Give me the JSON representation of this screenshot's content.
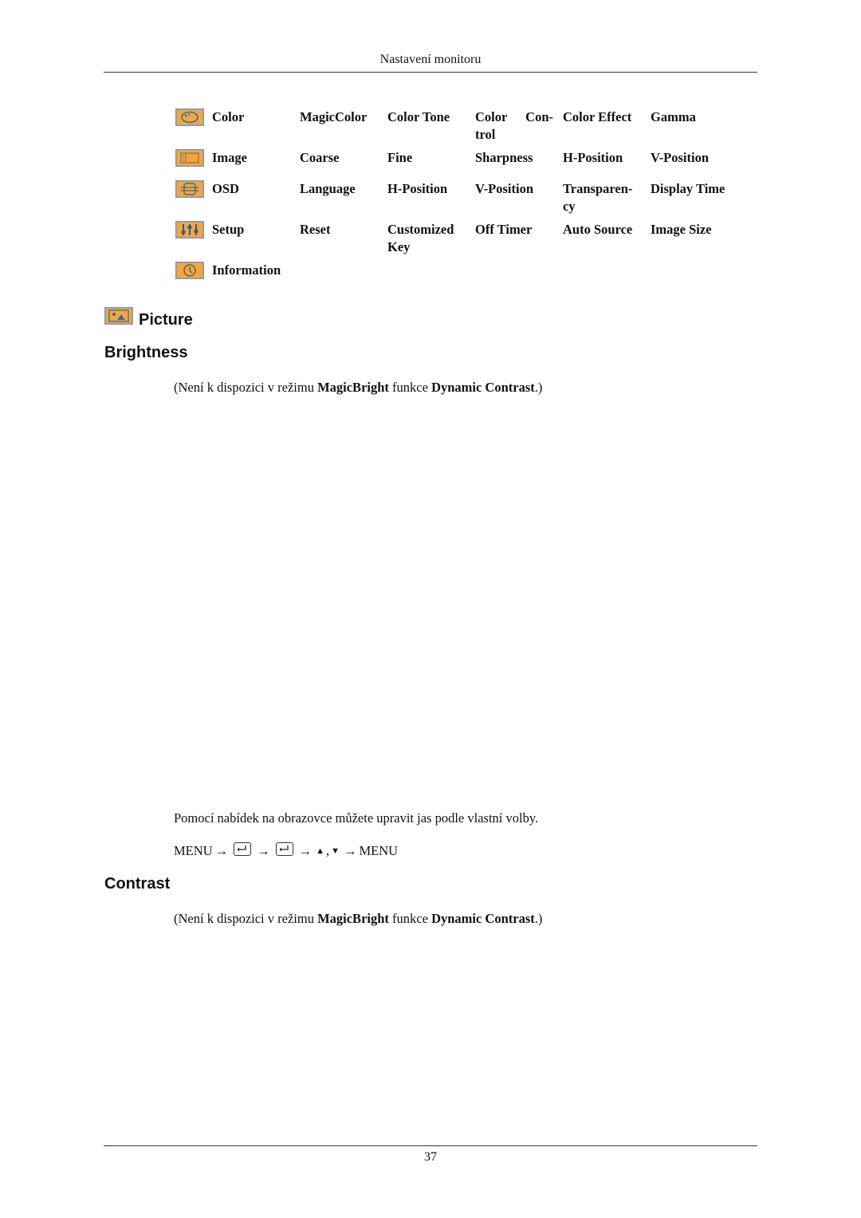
{
  "header": {
    "title": "Nastavení monitoru"
  },
  "menu_table": {
    "rows": [
      {
        "icon": "color-palette-icon",
        "cells": [
          "Color",
          "MagicColor",
          "Color Tone",
          "Color Con-trol",
          "Color Effect",
          "Gamma"
        ]
      },
      {
        "icon": "image-icon",
        "cells": [
          "Image",
          "Coarse",
          "Fine",
          "Sharpness",
          "H-Position",
          "V-Position"
        ]
      },
      {
        "icon": "osd-icon",
        "cells": [
          "OSD",
          "Language",
          "H-Position",
          "V-Position",
          "Transparen-cy",
          "Display Time"
        ]
      },
      {
        "icon": "setup-sliders-icon",
        "cells": [
          "Setup",
          "Reset",
          "Customized Key",
          "Off Timer",
          "Auto Source",
          "Image Size"
        ]
      },
      {
        "icon": "information-icon",
        "cells": [
          "Information"
        ]
      }
    ]
  },
  "section": {
    "icon": "picture-icon",
    "title": "Picture"
  },
  "brightness": {
    "heading": "Brightness",
    "note": {
      "pre": "(Není k dispozici v režimu ",
      "b1": "MagicBright",
      "mid": " funkce ",
      "b2": "Dynamic Contrast",
      "post": ".)"
    },
    "body": "Pomocí nabídek na obrazovce můžete upravit jas podle vlastní volby.",
    "path": {
      "start": "MENU",
      "arrow": "→",
      "up": "▲",
      "sep": ",",
      "down": "▼",
      "end": "MENU"
    }
  },
  "contrast": {
    "heading": "Contrast",
    "note": {
      "pre": "(Není k dispozici v režimu ",
      "b1": "MagicBright",
      "mid": " funkce ",
      "b2": "Dynamic Contrast",
      "post": ".)"
    }
  },
  "footer": {
    "page_number": "37"
  },
  "colors": {
    "icon_fill": "#F5A540",
    "icon_border": "#6E9AC4",
    "icon_glyph": "#3A6E98"
  }
}
